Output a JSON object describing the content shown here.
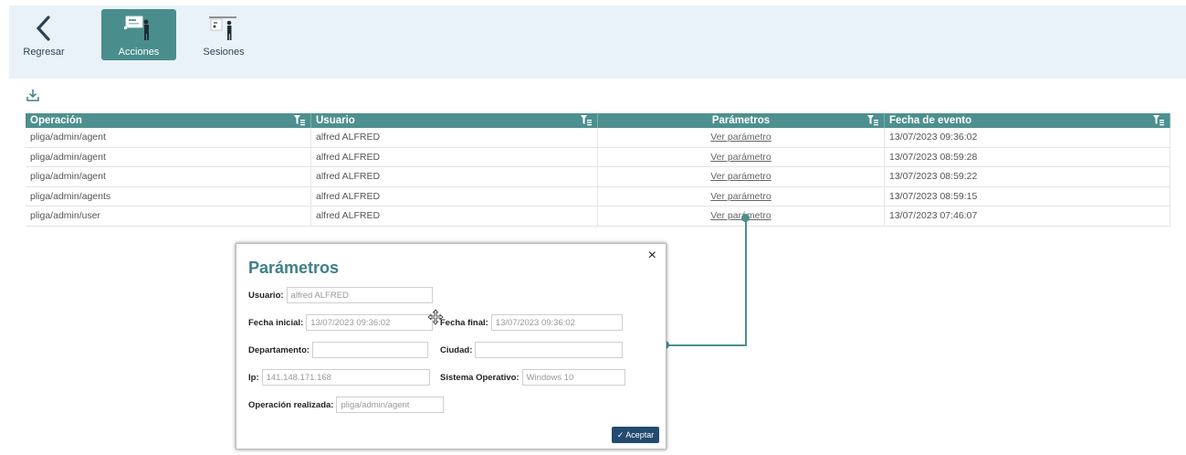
{
  "nav": {
    "back_label": "Regresar",
    "acciones_label": "Acciones",
    "sesiones_label": "Sesiones"
  },
  "table": {
    "headers": [
      "Operación",
      "Usuario",
      "Parámetros",
      "Fecha de evento"
    ],
    "rows": [
      {
        "operacion": "pliga/admin/agent",
        "usuario": "alfred ALFRED",
        "parametros": "Ver parámetro",
        "fecha": "13/07/2023 09:36:02"
      },
      {
        "operacion": "pliga/admin/agent",
        "usuario": "alfred ALFRED",
        "parametros": "Ver parámetro",
        "fecha": "13/07/2023 08:59:28"
      },
      {
        "operacion": "pliga/admin/agent",
        "usuario": "alfred ALFRED",
        "parametros": "Ver parámetro",
        "fecha": "13/07/2023 08:59:22"
      },
      {
        "operacion": "pliga/admin/agents",
        "usuario": "alfred ALFRED",
        "parametros": "Ver parámetro",
        "fecha": "13/07/2023 08:59:15"
      },
      {
        "operacion": "pliga/admin/user",
        "usuario": "alfred ALFRED",
        "parametros": "Ver parámetro",
        "fecha": "13/07/2023 07:46:07"
      }
    ]
  },
  "modal": {
    "title": "Parámetros",
    "close_glyph": "×",
    "usuario_label": "Usuario:",
    "usuario_value": "alfred ALFRED",
    "fecha_inicial_label": "Fecha inicial:",
    "fecha_inicial_value": "13/07/2023 09:36:02",
    "fecha_final_label": "Fecha final:",
    "fecha_final_value": "13/07/2023 09:36:02",
    "departamento_label": "Departamento:",
    "departamento_value": "",
    "ciudad_label": "Ciudad:",
    "ciudad_value": "",
    "ip_label": "Ip:",
    "ip_value": "141.148.171.168",
    "so_label": "Sistema Operativo:",
    "so_value": "Windows 10",
    "operacion_label": "Operación realizada:",
    "operacion_value": "pliga/admin/agent",
    "accept_label": "✓ Aceptar"
  },
  "colors": {
    "accent": "#4e8f8f",
    "title": "#3f7f86",
    "button": "#244a70",
    "topbar": "#eaf2f9"
  }
}
